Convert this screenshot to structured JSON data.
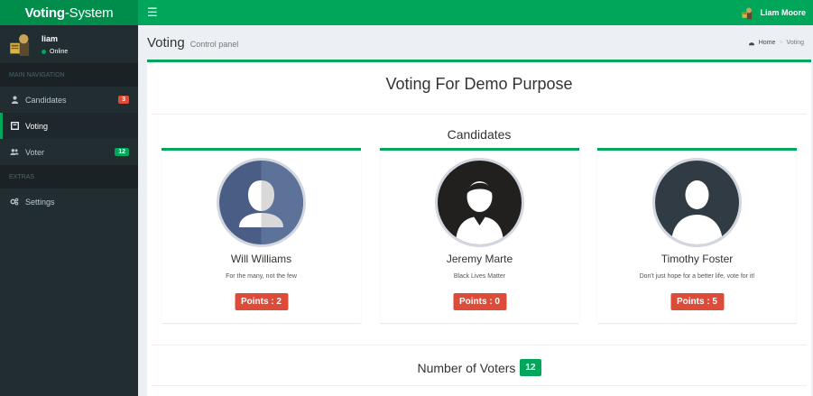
{
  "brand": {
    "bold": "Voting",
    "light": "-System"
  },
  "topbar": {
    "user_name": "Liam Moore"
  },
  "sidebar": {
    "user": {
      "name": "liam",
      "status": "Online"
    },
    "main_header": "MAIN NAVIGATION",
    "items": [
      {
        "label": "Candidates",
        "icon": "user-tie-icon",
        "badge": "3",
        "badge_color": "#dd4b39"
      },
      {
        "label": "Voting",
        "icon": "ballot-box-icon",
        "active": true
      },
      {
        "label": "Voter",
        "icon": "users-icon",
        "badge": "12",
        "badge_color": "#00a65a"
      }
    ],
    "extras_header": "EXTRAS",
    "extras": [
      {
        "label": "Settings",
        "icon": "cogs-icon"
      }
    ]
  },
  "content_header": {
    "title": "Voting",
    "subtitle": "Control panel",
    "breadcrumb": [
      "Home",
      "Voting"
    ]
  },
  "main": {
    "title": "Voting For Demo Purpose",
    "candidates_heading": "Candidates",
    "candidates": [
      {
        "name": "Will Williams",
        "slogan": "For the many, not the few",
        "points": "Points : 2"
      },
      {
        "name": "Jeremy Marte",
        "slogan": "Black Lives Matter",
        "points": "Points : 0"
      },
      {
        "name": "Timothy Foster",
        "slogan": "Don't just hope for a better life, vote for it!",
        "points": "Points : 5"
      }
    ],
    "voters_label": "Number of Voters",
    "voters_count": "12"
  },
  "colors": {
    "accent": "#00a65a",
    "accent_dark": "#008d4c",
    "sidebar": "#222d32",
    "danger": "#dd4b39"
  }
}
